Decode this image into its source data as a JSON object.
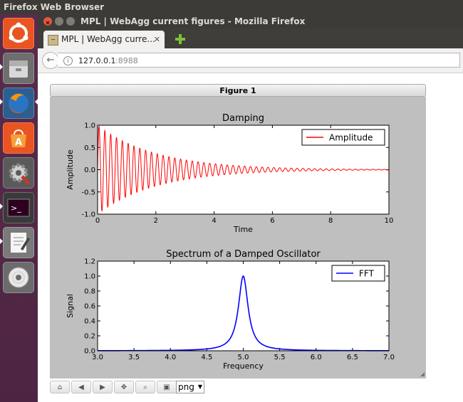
{
  "os": {
    "topbar_title": "Firefox Web Browser",
    "launcher_items": [
      {
        "name": "ubuntu-dash-icon",
        "color": "#e95420",
        "active": false
      },
      {
        "name": "files-icon",
        "color": "#8a8a8a",
        "active": false
      },
      {
        "name": "firefox-icon",
        "color": "#e66000",
        "active": true
      },
      {
        "name": "software-center-icon",
        "color": "#e95420",
        "active": false
      },
      {
        "name": "system-settings-icon",
        "color": "#c0392b",
        "active": false
      },
      {
        "name": "terminal-icon",
        "color": "#2c2c2c",
        "active": false
      },
      {
        "name": "text-editor-icon",
        "color": "#d8d8d8",
        "active": false
      },
      {
        "name": "dvd-icon",
        "color": "#aaaaaa",
        "active": false
      }
    ]
  },
  "browser": {
    "window_title": "MPL | WebAgg current figures - Mozilla Firefox",
    "tab_title": "MPL | WebAgg curre...",
    "url_host": "127.0.0.1",
    "url_port": ":8988"
  },
  "figure": {
    "title": "Figure 1",
    "format_options": [
      "png"
    ],
    "format_selected": "png",
    "toolbar_icons": [
      "home-icon",
      "back-arrow-icon",
      "forward-arrow-icon",
      "pan-icon",
      "zoom-icon",
      "save-icon"
    ]
  },
  "chart_data": [
    {
      "type": "line",
      "title": "Damping",
      "xlabel": "Time",
      "ylabel": "Amplitude",
      "xlim": [
        0,
        10
      ],
      "ylim": [
        -1.0,
        1.0
      ],
      "xticks": [
        "0",
        "2",
        "4",
        "6",
        "8",
        "10"
      ],
      "yticks": [
        "-1.0",
        "-0.5",
        "0.0",
        "0.5",
        "1.0"
      ],
      "legend_position": "top-right",
      "series": [
        {
          "name": "Amplitude",
          "color": "#ff0000",
          "function": "exp(-0.5*t)*sin(2*pi*5*t)",
          "x_range": [
            0,
            10
          ],
          "amplitude_decay_rate": 0.5,
          "frequency": 5
        }
      ]
    },
    {
      "type": "line",
      "title": "Spectrum of a Damped Oscillator",
      "xlabel": "Frequency",
      "ylabel": "Signal",
      "xlim": [
        3.0,
        7.0
      ],
      "ylim": [
        0.0,
        1.2
      ],
      "xticks": [
        "3.0",
        "3.5",
        "4.0",
        "4.5",
        "5.0",
        "5.5",
        "6.0",
        "6.5",
        "7.0"
      ],
      "yticks": [
        "0.0",
        "0.2",
        "0.4",
        "0.6",
        "0.8",
        "1.0",
        "1.2"
      ],
      "legend_position": "top-right",
      "series": [
        {
          "name": "FFT",
          "color": "#0000ff",
          "peak_x": 5.0,
          "peak_y": 1.0,
          "half_width": 0.08
        }
      ]
    }
  ]
}
